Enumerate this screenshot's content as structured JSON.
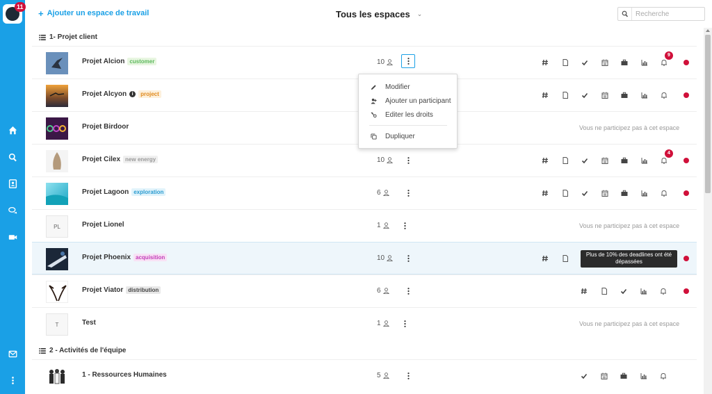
{
  "sidebar": {
    "notification_count": "11",
    "icons": [
      "home-icon",
      "search-icon",
      "contacts-icon",
      "chat-icon",
      "video-icon",
      "mail-icon",
      "more-vertical-icon"
    ]
  },
  "header": {
    "add_workspace_label": "Ajouter un espace de travail",
    "space_filter_label": "Tous les espaces",
    "search_placeholder": "Recherche"
  },
  "groups": [
    {
      "title": "1- Projet client"
    },
    {
      "title": "2 - Activités de l'équipe"
    }
  ],
  "projects": [
    {
      "name": "Projet Alcion",
      "tag": "customer",
      "tag_color": "#5cb85c",
      "tag_bg": "#e8f6e1",
      "count": "10",
      "bell_badge": "9"
    },
    {
      "name": "Projet Alcyon",
      "tag": "project",
      "tag_color": "#e08a1e",
      "tag_bg": "#fdf0dc"
    },
    {
      "name": "Projet Birdoor"
    },
    {
      "name": "Projet Cilex",
      "tag": "new energy",
      "tag_color": "#999999",
      "tag_bg": "#f0f0f0",
      "count": "10",
      "bell_badge": "4"
    },
    {
      "name": "Projet Lagoon",
      "tag": "exploration",
      "tag_color": "#2a9bd0",
      "tag_bg": "#e1f3fb",
      "count": "6"
    },
    {
      "name": "Projet Lionel",
      "initials": "PL",
      "count": "1"
    },
    {
      "name": "Projet Phoenix",
      "tag": "acquisition",
      "tag_color": "#c23cb8",
      "tag_bg": "#f8e1f5",
      "count": "10"
    },
    {
      "name": "Projet Viator",
      "tag": "distribution",
      "tag_color": "#444444",
      "tag_bg": "#e8e8e8",
      "count": "6"
    },
    {
      "name": "Test",
      "initials": "T",
      "count": "1"
    },
    {
      "name": "1 - Ressources Humaines",
      "count": "5"
    }
  ],
  "not_participating_text": "Vous ne participez pas à cet espace",
  "menu": {
    "edit": "Modifier",
    "add_participant": "Ajouter un participant",
    "edit_rights": "Editer les droits",
    "duplicate": "Dupliquer"
  },
  "tooltip": {
    "line1": "Plus de 10% des deadlines ont été",
    "line2": "dépassées"
  },
  "colors": {
    "accent": "#1aa0e6",
    "alert": "#d0103a"
  }
}
